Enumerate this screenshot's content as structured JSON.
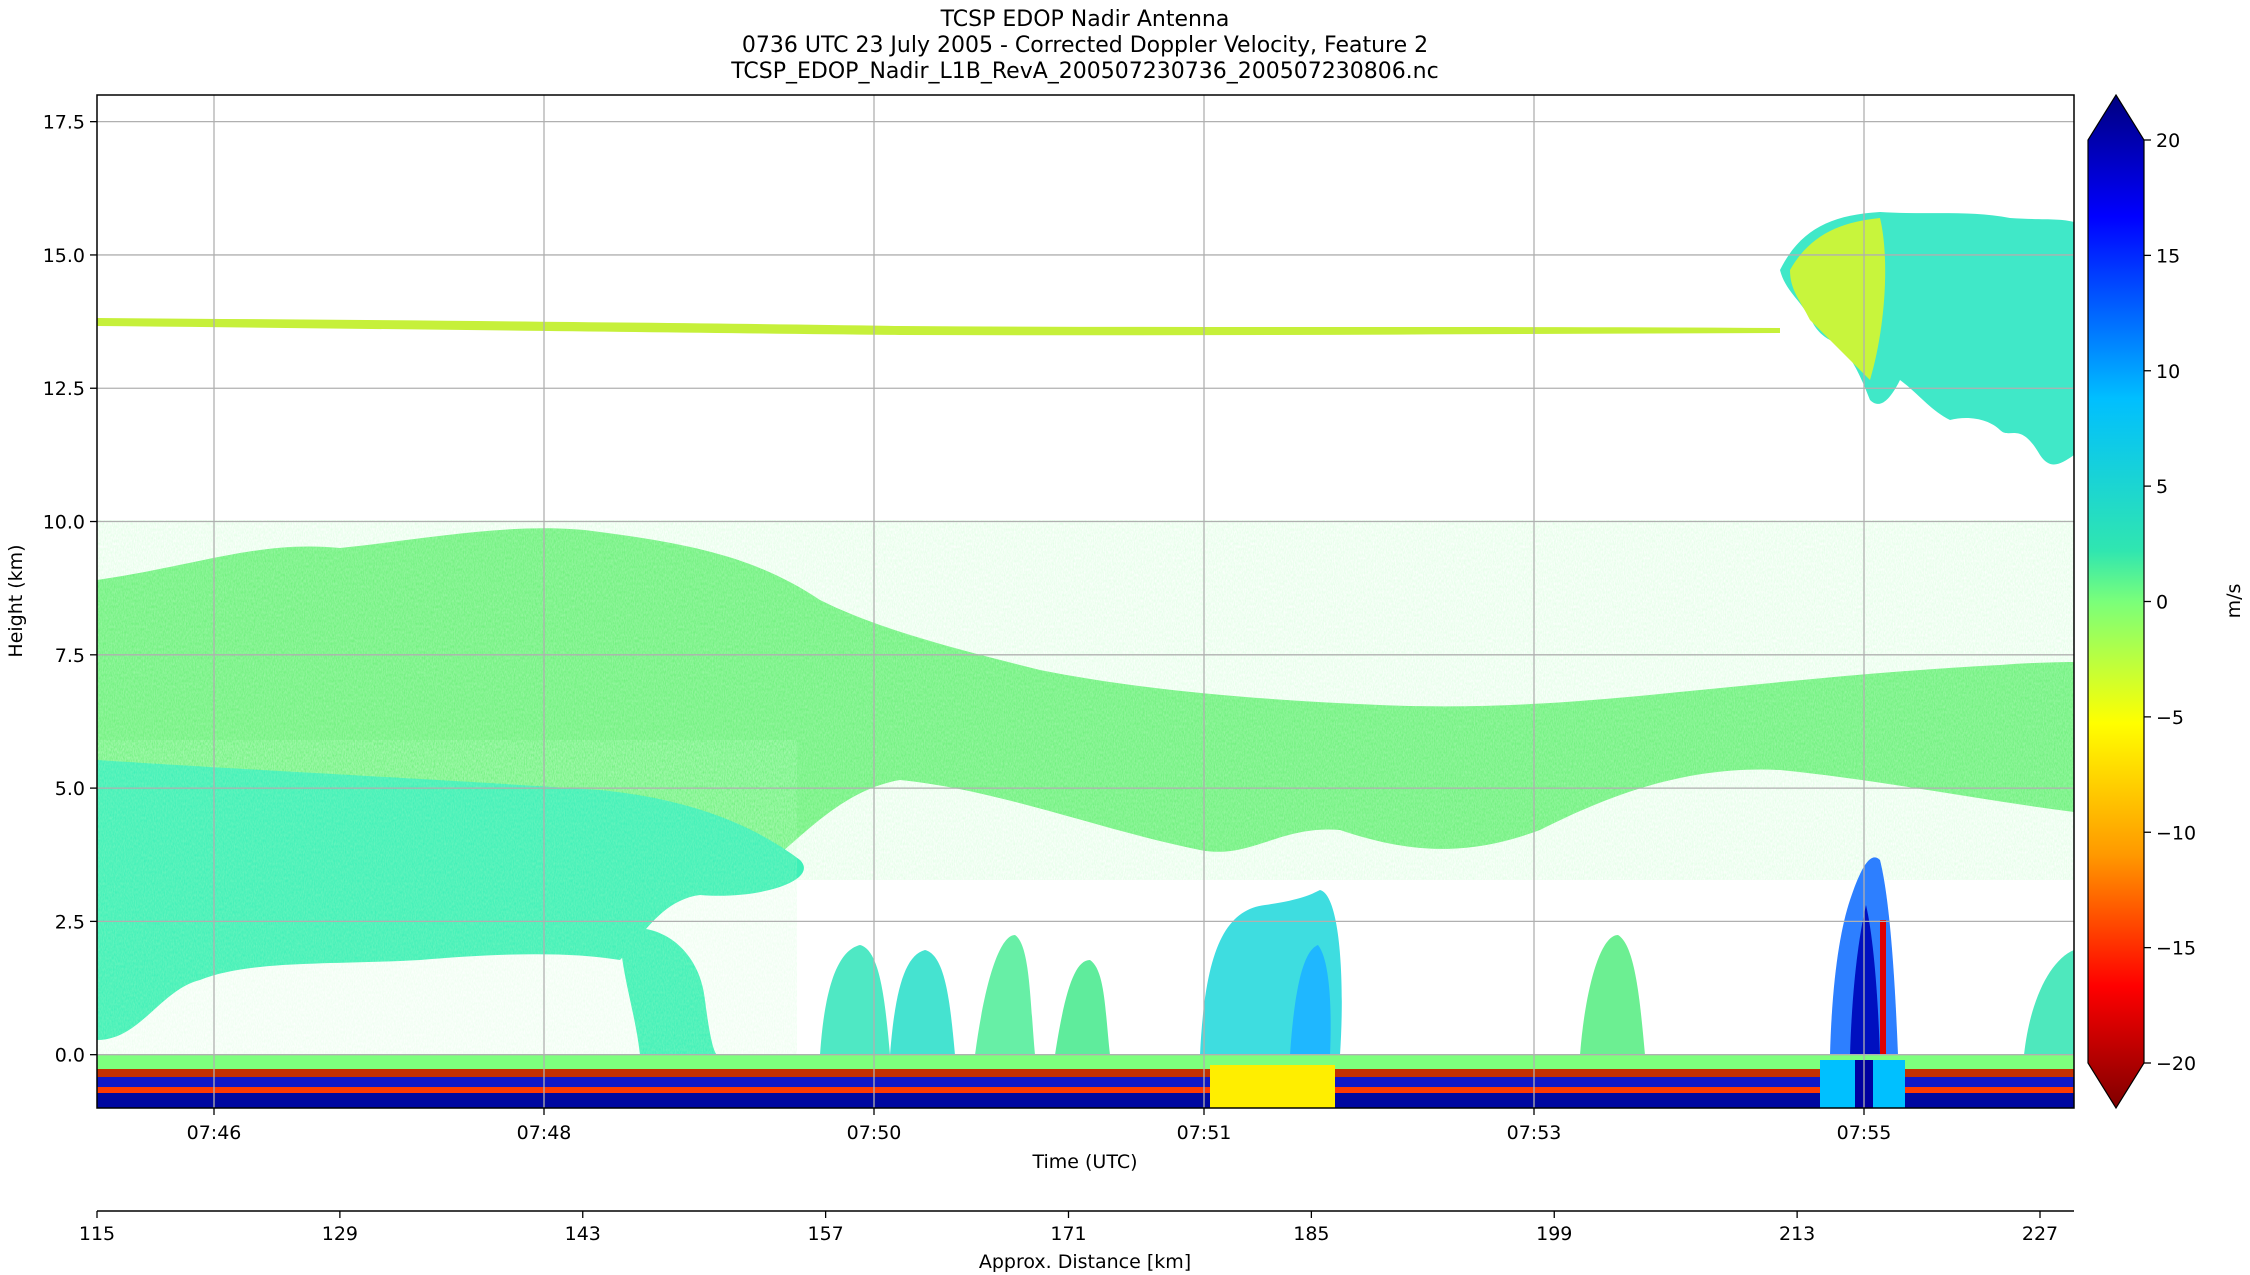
{
  "chart_data": {
    "type": "heatmap",
    "title_lines": [
      "TCSP EDOP Nadir Antenna",
      "0736 UTC 23 July 2005 - Corrected Doppler Velocity, Feature 2",
      "TCSP_EDOP_Nadir_L1B_RevA_200507230736_200507230806.nc"
    ],
    "xlabel": "Time (UTC)",
    "ylabel": "Height (km)",
    "x_ticks": [
      "07:46",
      "07:48",
      "07:50",
      "07:51",
      "07:53",
      "07:55"
    ],
    "y_ticks": [
      0.0,
      2.5,
      5.0,
      7.5,
      10.0,
      12.5,
      15.0,
      17.5
    ],
    "y_tick_labels": [
      "0.0",
      "2.5",
      "5.0",
      "7.5",
      "10.0",
      "12.5",
      "15.0",
      "17.5"
    ],
    "ylim": [
      -1.0,
      18.0
    ],
    "grid": true,
    "secondary_xlabel": "Approx. Distance [km]",
    "secondary_x_ticks": [
      "115",
      "129",
      "143",
      "157",
      "171",
      "185",
      "199",
      "213",
      "227"
    ],
    "colorbar": {
      "label": "m/s",
      "vmin": -20,
      "vmax": 20,
      "ticks": [
        "20",
        "15",
        "10",
        "5",
        "0",
        "−5",
        "−10",
        "−15",
        "−20"
      ],
      "colormap": "jet_r",
      "extend": "both"
    },
    "features": [
      {
        "name": "cirrus line",
        "height_km": [
          13.5,
          13.8
        ],
        "velocity_ms": -3
      },
      {
        "name": "anvil",
        "height_km": [
          11.0,
          15.8
        ],
        "velocity_ms": 3
      },
      {
        "name": "stratiform layer",
        "height_km": [
          0.0,
          9.5
        ],
        "velocity_ms": 1
      },
      {
        "name": "convective core",
        "height_km": [
          0.0,
          3.8
        ],
        "velocity_ms": 15
      },
      {
        "name": "surface clutter",
        "height_km": [
          -1.0,
          0.0
        ],
        "velocity_ms": 20
      }
    ]
  }
}
